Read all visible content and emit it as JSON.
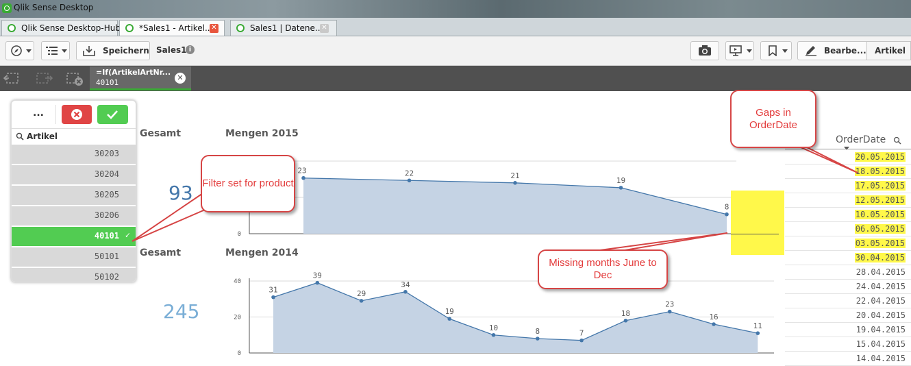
{
  "window": {
    "title": "Qlik Sense Desktop"
  },
  "tabs": [
    {
      "label": "Qlik Sense Desktop-Hub"
    },
    {
      "label": "*Sales1 - Artikel..."
    },
    {
      "label": "Sales1 | Datene..."
    }
  ],
  "toolbar": {
    "save_label": "Speichern",
    "app_name": "Sales1",
    "edit_label": "Bearbe...",
    "sheet_label": "Artikel"
  },
  "selection": {
    "field": "=If(ArtikelArtNr...",
    "value": "40101"
  },
  "listbox": {
    "more_label": "...",
    "title": "Artikel",
    "items": [
      {
        "label": "30203",
        "selected": false
      },
      {
        "label": "30204",
        "selected": false
      },
      {
        "label": "30205",
        "selected": false
      },
      {
        "label": "30206",
        "selected": false
      },
      {
        "label": "40101",
        "selected": true
      },
      {
        "label": "50101",
        "selected": false
      },
      {
        "label": "50102",
        "selected": false
      }
    ]
  },
  "kpi_2015": {
    "title": "Gesamt",
    "value": "93"
  },
  "kpi_2014": {
    "title": "Gesamt",
    "value": "245"
  },
  "chart_data": [
    {
      "type": "area",
      "title": "Mengen 2015",
      "values": [
        23,
        22,
        21,
        19,
        8
      ],
      "ytick_labels": [
        "0"
      ],
      "ylim": [
        0,
        30
      ],
      "color": "#4477aa",
      "fill": "#c5d3e4"
    },
    {
      "type": "area",
      "title": "Mengen 2014",
      "values": [
        31,
        39,
        29,
        34,
        19,
        10,
        8,
        7,
        18,
        23,
        16,
        11
      ],
      "ytick_labels": [
        "40",
        "20",
        "0"
      ],
      "ylim": [
        0,
        40
      ],
      "color": "#4477aa",
      "fill": "#c5d3e4"
    }
  ],
  "order_table": {
    "header": "OrderDate",
    "rows": [
      {
        "date": "20.05.2015",
        "highlight": true
      },
      {
        "date": "18.05.2015",
        "highlight": true
      },
      {
        "date": "17.05.2015",
        "highlight": true
      },
      {
        "date": "12.05.2015",
        "highlight": true
      },
      {
        "date": "10.05.2015",
        "highlight": true
      },
      {
        "date": "06.05.2015",
        "highlight": true
      },
      {
        "date": "03.05.2015",
        "highlight": true
      },
      {
        "date": "30.04.2015",
        "highlight": true
      },
      {
        "date": "28.04.2015",
        "highlight": false
      },
      {
        "date": "24.04.2015",
        "highlight": false
      },
      {
        "date": "22.04.2015",
        "highlight": false
      },
      {
        "date": "20.04.2015",
        "highlight": false
      },
      {
        "date": "19.04.2015",
        "highlight": false
      },
      {
        "date": "15.04.2015",
        "highlight": false
      },
      {
        "date": "14.04.2015",
        "highlight": false
      }
    ]
  },
  "annotations": {
    "filter": "Filter set for product",
    "gaps": "Gaps in OrderDate",
    "missing": "Missing months June to Dec"
  },
  "colors": {
    "green": "#52cc52",
    "red": "#e04545",
    "accent": "#4477aa",
    "highlight": "#fff84a",
    "callout": "#e33b3b"
  }
}
